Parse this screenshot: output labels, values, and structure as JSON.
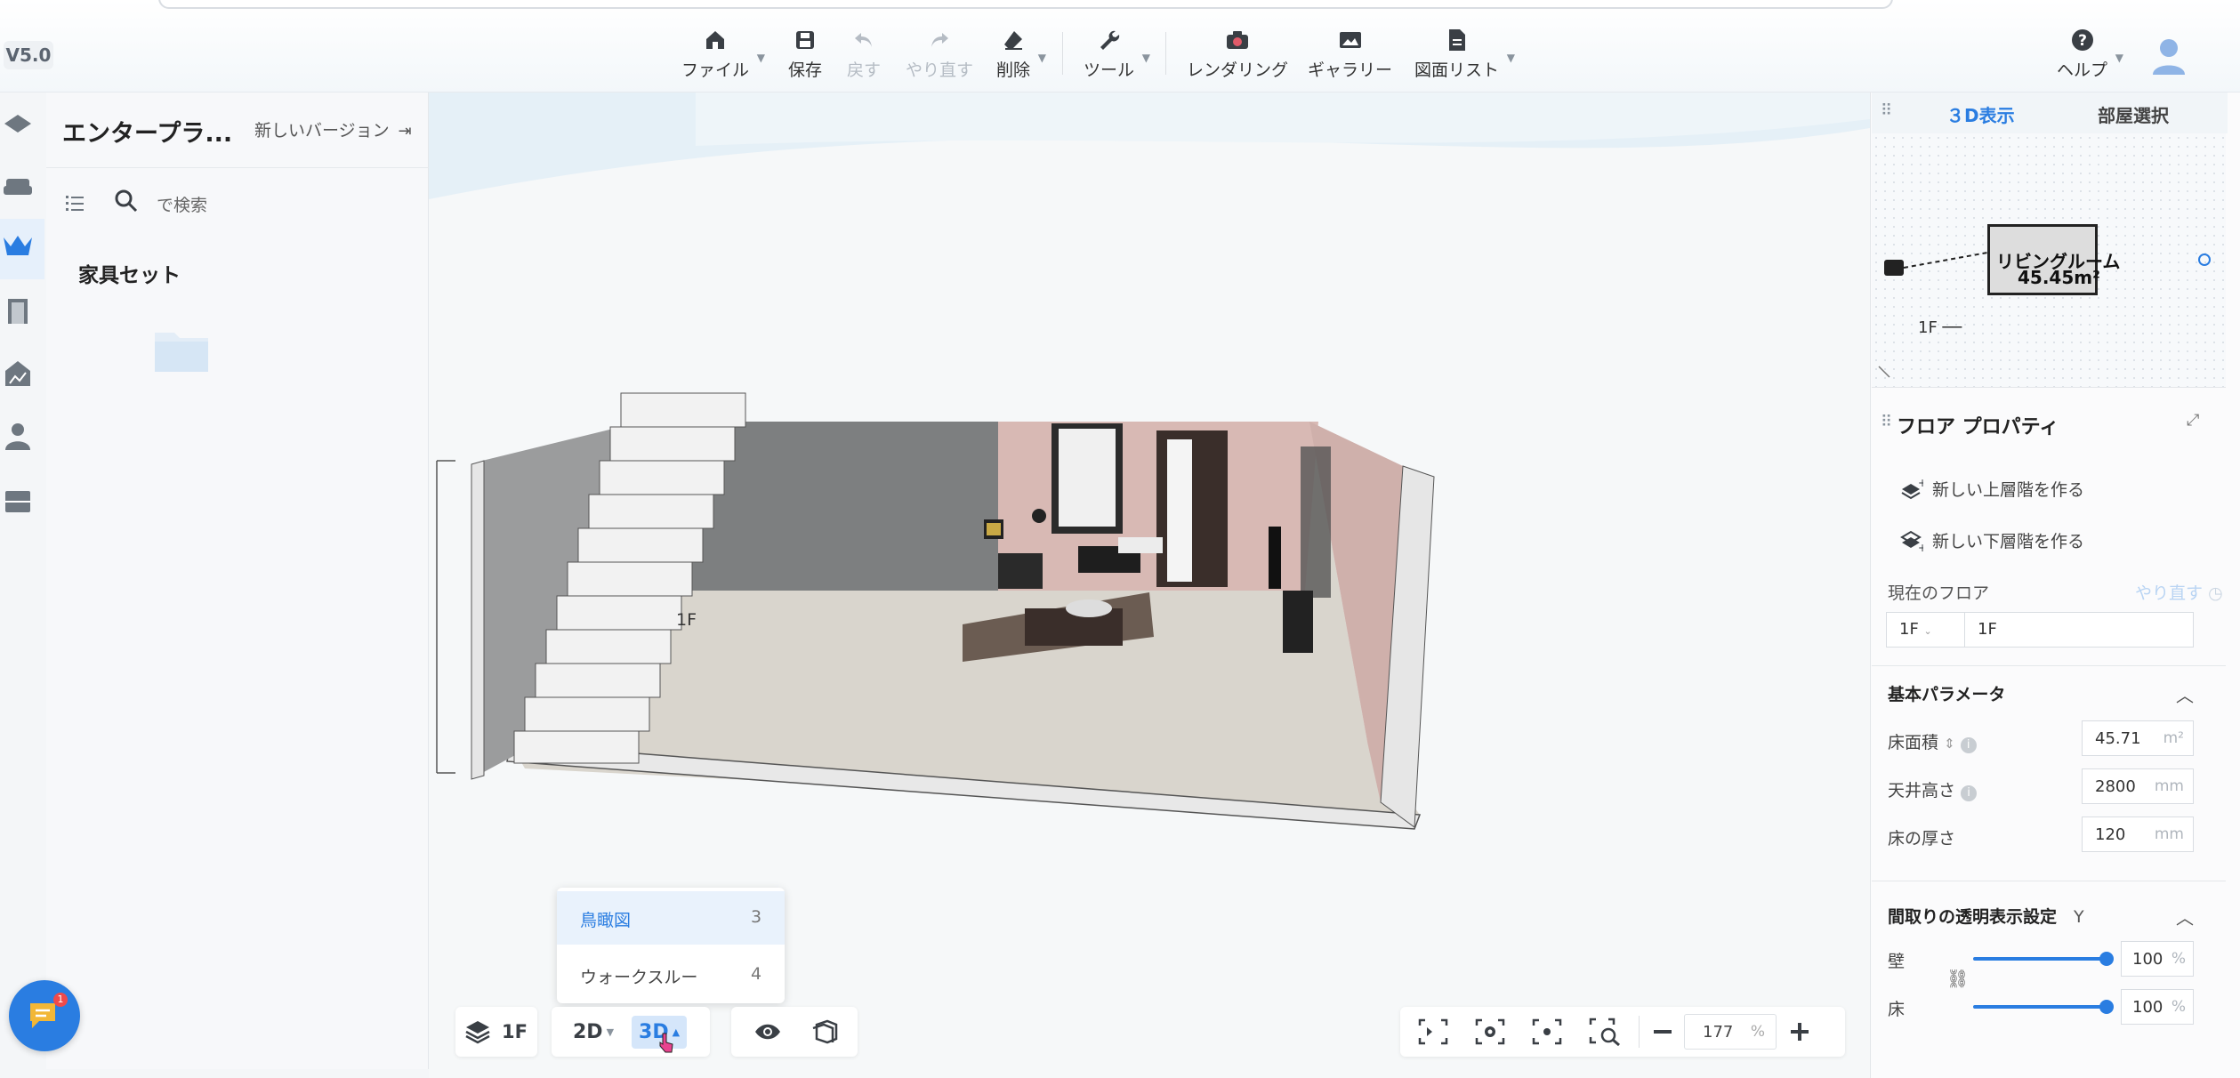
{
  "version": "V5.0",
  "toolbar": {
    "file": "ファイル",
    "save": "保存",
    "undo": "戻す",
    "redo": "やり直す",
    "delete": "削除",
    "tools": "ツール",
    "rendering": "レンダリング",
    "gallery": "ギャラリー",
    "drawing_list": "図面リスト",
    "help": "ヘルプ"
  },
  "left_panel": {
    "title": "エンタープラ...",
    "new_version": "新しいバージョン",
    "search_placeholder": "で検索",
    "section": "家具セット"
  },
  "canvas": {
    "floor_label": "1F"
  },
  "right_panel": {
    "tabs": [
      "３D表示",
      "部屋選択"
    ],
    "minimap": {
      "room_name": "リビングルーム",
      "room_area": "45.45m²",
      "floor": "1F"
    },
    "floor_properties": {
      "title": "フロア プロパティ",
      "new_upper": "新しい上層階を作る",
      "new_lower": "新しい下層階を作る",
      "current_floor_label": "現在のフロア",
      "redo": "やり直す",
      "floor_select": "1F",
      "floor_name": "1F"
    },
    "basic_params": {
      "title": "基本パラメータ",
      "floor_area_label": "床面積",
      "floor_area_value": "45.71",
      "floor_area_unit": "m²",
      "ceiling_height_label": "天井高さ",
      "ceiling_height_value": "2800",
      "ceiling_height_unit": "mm",
      "floor_thickness_label": "床の厚さ",
      "floor_thickness_value": "120",
      "floor_thickness_unit": "mm"
    },
    "transparency": {
      "title": "間取りの透明表示設定",
      "shortcut": "Y",
      "wall_label": "壁",
      "wall_value": "100",
      "floor_label": "床",
      "floor_value": "100",
      "unit": "%",
      "wall_level": 1.0,
      "floor_level": 1.0
    }
  },
  "bottom_bar": {
    "floor": "1F",
    "view_2d": "2D",
    "view_3d": "3D",
    "zoom_value": "177",
    "zoom_unit": "%"
  },
  "view_menu": {
    "items": [
      {
        "label": "鳥瞰図",
        "shortcut": "3"
      },
      {
        "label": "ウォークスルー",
        "shortcut": "4"
      }
    ]
  },
  "chat": {
    "badge": "1"
  },
  "colors": {
    "accent": "#2a7de1",
    "accent_light": "#e9f2fc"
  }
}
